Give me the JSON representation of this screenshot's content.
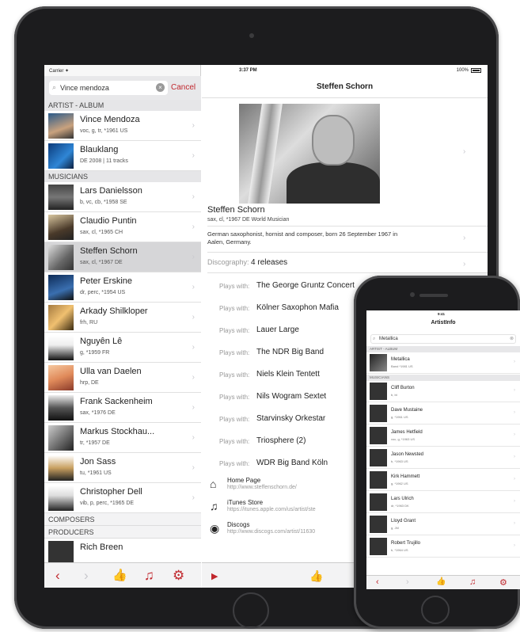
{
  "ipad": {
    "status": {
      "carrier": "Carrier ✦",
      "time": "3:37 PM",
      "battery": "100%"
    },
    "master": {
      "search": {
        "query": "Vince mendoza",
        "cancel_label": "Cancel"
      },
      "section_artist_album": "ARTIST - ALBUM",
      "artist_album_rows": [
        {
          "name": "Vince Mendoza",
          "sub": "voc, g, tr, *1961 US"
        },
        {
          "name": "Blauklang",
          "sub": "DE 2008 | 11 tracks"
        }
      ],
      "section_musicians": "MUSICIANS",
      "musician_rows": [
        {
          "name": "Lars Danielsson",
          "sub": "b, vc, cb, *1958 SE"
        },
        {
          "name": "Claudio Puntin",
          "sub": "sax, cl, *1965 CH"
        },
        {
          "name": "Steffen Schorn",
          "sub": "sax, cl, *1967 DE"
        },
        {
          "name": "Peter Erskine",
          "sub": "dr, perc, *1954 US"
        },
        {
          "name": "Arkady Shilkloper",
          "sub": "frh, RU"
        },
        {
          "name": "Nguyên Lê",
          "sub": "g, *1959 FR"
        },
        {
          "name": "Ulla van Daelen",
          "sub": "hrp, DE"
        },
        {
          "name": "Frank Sackenheim",
          "sub": "sax, *1976 DE"
        },
        {
          "name": "Markus Stockhau...",
          "sub": "tr, *1957 DE"
        },
        {
          "name": "Jon Sass",
          "sub": "tu, *1961 US"
        },
        {
          "name": "Christopher Dell",
          "sub": "vib, p, perc, *1965 DE"
        }
      ],
      "section_composers": "COMPOSERS",
      "section_producers": "PRODUCERS",
      "partial_row": "Rich Breen",
      "toolbar": {
        "back": "‹",
        "forward": "›",
        "like": "👍",
        "music": "♫",
        "settings": "⚙"
      }
    },
    "detail": {
      "title": "Steffen Schorn",
      "name": "Steffen Schorn",
      "sub": "sax, cl, *1967 DE World Musician",
      "bio": "German saxophonist, hornist and composer, born 26 September 1967 in Aalen, Germany.",
      "discography_label": "Discography:",
      "discography_value": "4 releases",
      "plays_label": "Plays with:",
      "plays_with": [
        "The George Gruntz Concert",
        "Kölner Saxophon Mafia",
        "Lauer Large",
        "The NDR Big Band",
        "Niels Klein Tentett",
        "Nils Wogram Sextet",
        "Starvinsky Orkestar",
        "Triosphere (2)",
        "WDR Big Band Köln"
      ],
      "links": [
        {
          "icon": "home-icon",
          "title": "Home Page",
          "url": "http://www.steffenschorn.de/"
        },
        {
          "icon": "itunes-icon",
          "title": "iTunes Store",
          "url": "https://itunes.apple.com/us/artist/ste"
        },
        {
          "icon": "disc-icon",
          "title": "Discogs",
          "url": "http://www.discogs.com/artist/11630"
        }
      ],
      "toolbar": {
        "play": "▶",
        "like_add": "👍"
      }
    }
  },
  "iphone": {
    "status": {
      "time": "9:41"
    },
    "title": "ArtistInfo",
    "search_query": "Metallica",
    "section_artist_album": "ARTIST - ALBUM",
    "artist_album_rows": [
      {
        "name": "Metallica",
        "sub": "Band *1981 US"
      }
    ],
    "section_musicians": "MUSICIANS",
    "musician_rows": [
      {
        "name": "Cliff Burton",
        "sub": "b, bt"
      },
      {
        "name": "Dave Mustaine",
        "sub": "g, *1961 US"
      },
      {
        "name": "James Hetfield",
        "sub": "voc, g, *1963 US"
      },
      {
        "name": "Jason Newsted",
        "sub": "b, *1963 US"
      },
      {
        "name": "Kirk Hammett",
        "sub": "g, *1962 US"
      },
      {
        "name": "Lars Ulrich",
        "sub": "dr, *1963 DK"
      },
      {
        "name": "Lloyd Grant",
        "sub": "g, JM"
      },
      {
        "name": "Robert Trujillo",
        "sub": "b, *1964 US"
      }
    ],
    "toolbar": {
      "back": "‹",
      "forward": "›",
      "like": "👍",
      "music": "♫",
      "settings": "⚙"
    }
  },
  "colors": {
    "accent": "#c0272d"
  }
}
